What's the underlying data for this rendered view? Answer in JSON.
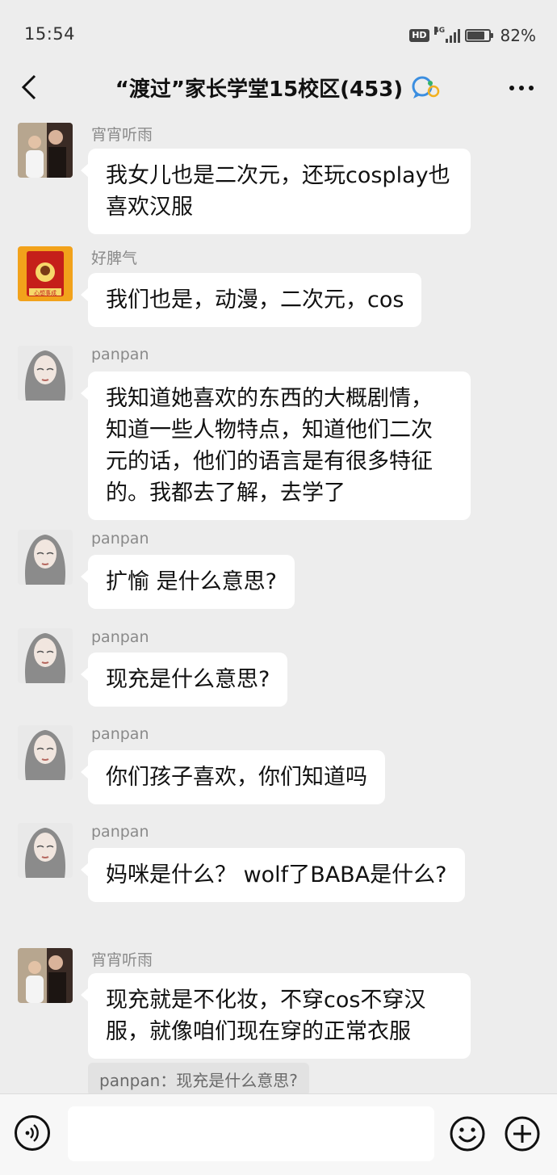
{
  "status_bar": {
    "time": "15:54",
    "hd": "HD",
    "network": "4G",
    "battery_percent": "82%",
    "battery_level": 0.82
  },
  "header": {
    "title": "“渡过”家长学堂15校区(453)",
    "icons": [
      "back-arrow-icon",
      "chat-group-icon",
      "more-icon"
    ]
  },
  "messages": [
    {
      "sender": "宵宵听雨",
      "text": "我女儿也是二次元，还玩cosplay也喜欢汉服",
      "avatar": "photo-avatar"
    },
    {
      "sender": "好脾气",
      "text": "我们也是，动漫，二次元，cos",
      "avatar": "red-box-avatar"
    },
    {
      "sender": "panpan",
      "text": "我知道她喜欢的东西的大概剧情，知道一些人物特点，知道他们二次元的话，他们的语言是有很多特征的。我都去了解，去学了",
      "avatar": "woman-avatar"
    },
    {
      "sender": "panpan",
      "text": "扩愉 是什么意思?",
      "avatar": "woman-avatar"
    },
    {
      "sender": "panpan",
      "text": "现充是什么意思?",
      "avatar": "woman-avatar"
    },
    {
      "sender": "panpan",
      "text": "你们孩子喜欢，你们知道吗",
      "avatar": "woman-avatar"
    },
    {
      "sender": "panpan",
      "text": "妈咪是什么？  wolf了BABA是什么?",
      "avatar": "woman-avatar"
    },
    {
      "sender": "宵宵听雨",
      "text": "现充就是不化妆，不穿cos不穿汉服，就像咱们现在穿的正常衣服",
      "avatar": "photo-avatar"
    }
  ],
  "quote": "panpan：现充是什么意思?",
  "avatar_text": {
    "red_box_label": "心想事成"
  },
  "input_bar": {
    "icons": [
      "voice-icon",
      "emoji-icon",
      "plus-icon"
    ],
    "placeholder": ""
  },
  "colors": {
    "background": "#ededed",
    "bubble": "#ffffff",
    "sender_name": "#8a8a8a",
    "quote_bg": "#e2e2e2"
  }
}
